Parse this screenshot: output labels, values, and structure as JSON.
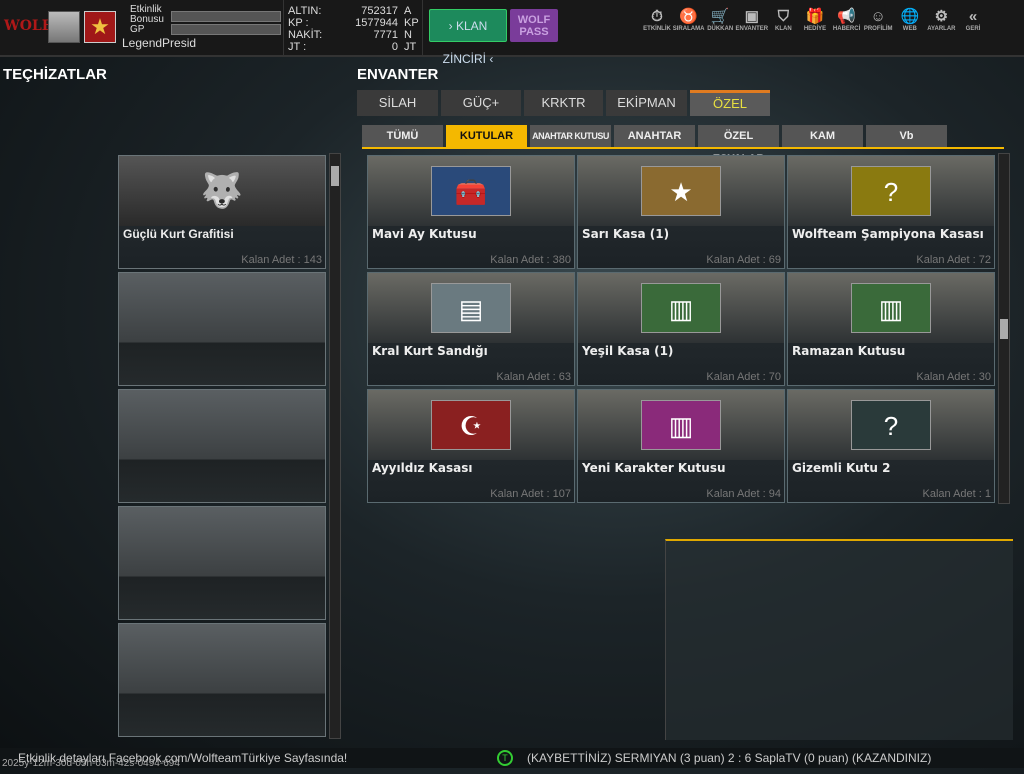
{
  "header": {
    "logo_text": "WOLF",
    "event_bonus_label": "Etkinlik Bonusu",
    "gp_label": "GP",
    "username": "LegendPresid",
    "currencies": [
      {
        "label": "ALTIN:",
        "value": "752317",
        "unit": "A"
      },
      {
        "label": "KP :",
        "value": "1577944",
        "unit": "KP"
      },
      {
        "label": "NAKİT:",
        "value": "7771",
        "unit": "N"
      },
      {
        "label": "JT :",
        "value": "0",
        "unit": "JT"
      }
    ],
    "klan_button": "› KLAN ZİNCİRİ ‹",
    "wolf_pass": "WOLF PASS",
    "nav": [
      {
        "label": "ETKİNLİK",
        "icon": "⏱"
      },
      {
        "label": "SIRALAMA",
        "icon": "♉"
      },
      {
        "label": "DÜKKAN",
        "icon": "🛒"
      },
      {
        "label": "ENVANTER",
        "icon": "▣"
      },
      {
        "label": "KLAN",
        "icon": "⛉"
      },
      {
        "label": "HEDİYE",
        "icon": "🎁"
      },
      {
        "label": "HABERCİ",
        "icon": "📢"
      },
      {
        "label": "PROFİLİM",
        "icon": "☺"
      },
      {
        "label": "WEB",
        "icon": "🌐"
      },
      {
        "label": "AYARLAR",
        "icon": "⚙"
      },
      {
        "label": "GERİ",
        "icon": "«"
      }
    ]
  },
  "left": {
    "title": "TEÇHİZATLAR",
    "items": [
      {
        "name": "Güçlü Kurt Grafitisi",
        "qty": "Kalan Adet : 143"
      }
    ]
  },
  "inventory": {
    "title": "ENVANTER",
    "tabs": [
      "SİLAH",
      "GÜÇ+",
      "KRKTR",
      "EKİPMAN",
      "ÖZEL"
    ],
    "subtabs": [
      "TÜMÜ",
      "KUTULAR",
      "ANAHTAR KUTUSU",
      "ANAHTAR",
      "ÖZEL EŞYALAR",
      "KAM",
      "Vb"
    ],
    "items": [
      {
        "name": "Mavi Ay Kutusu",
        "qty": "Kalan Adet : 380",
        "icon": "🧰",
        "color": "#2a4a7a"
      },
      {
        "name": "Sarı Kasa (1)",
        "qty": "Kalan Adet : 69",
        "icon": "★",
        "color": "#8a6a30"
      },
      {
        "name": "Wolfteam Şampiyona Kasası",
        "qty": "Kalan Adet : 72",
        "icon": "?",
        "color": "#8a7a10"
      },
      {
        "name": "Kral Kurt Sandığı",
        "qty": "Kalan Adet : 63",
        "icon": "▤",
        "color": "#6a7a80"
      },
      {
        "name": "Yeşil Kasa (1)",
        "qty": "Kalan Adet : 70",
        "icon": "▥",
        "color": "#3a6a3a"
      },
      {
        "name": "Ramazan Kutusu",
        "qty": "Kalan Adet : 30",
        "icon": "▥",
        "color": "#3a6a3a"
      },
      {
        "name": "Ayyıldız Kasası",
        "qty": "Kalan Adet : 107",
        "icon": "☪",
        "color": "#8a2020"
      },
      {
        "name": "Yeni Karakter Kutusu",
        "qty": "Kalan Adet : 94",
        "icon": "▥",
        "color": "#8a2a7a"
      },
      {
        "name": "Gizemli Kutu 2",
        "qty": "Kalan Adet : 1",
        "icon": "?",
        "color": "#2a3a3a"
      }
    ]
  },
  "status": {
    "ticker": "Etkinlik detayları Facebook.com/WolfteamTürkiye Sayfasında!",
    "timestamp": "2025y-12m-30d-05h-03m-42s-0494-694",
    "match": "(KAYBETTİNİZ) SERMIYAN (3 puan) 2 : 6 SaplaTV (0 puan) (KAZANDINIZ)"
  }
}
